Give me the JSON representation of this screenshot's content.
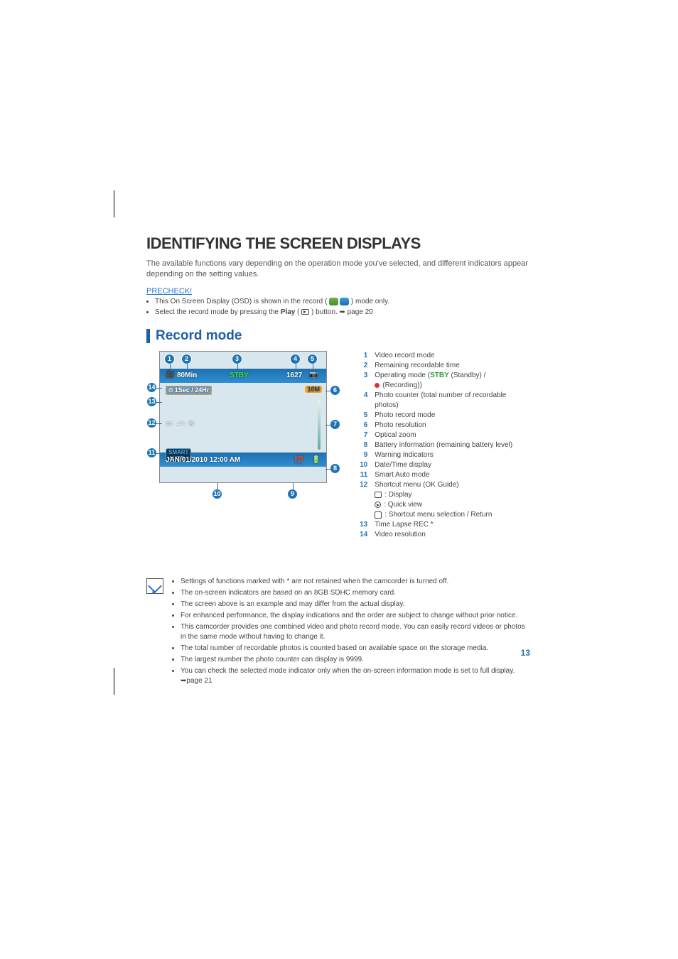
{
  "page_number": "13",
  "title": "IDENTIFYING THE SCREEN DISPLAYS",
  "intro": "The available functions vary depending on the operation mode you've selected, and different indicators appear depending on the setting values.",
  "precheck_label": "PRECHECK!",
  "precheck_items": {
    "a_pre": "This On Screen Display (OSD) is shown in the record (",
    "a_post": ") mode only.",
    "b_pre": "Select the record mode by pressing the ",
    "b_play": "Play",
    "b_mid": " (",
    "b_post": ") button. ",
    "b_ref": "page 20"
  },
  "section_title": "Record mode",
  "screen": {
    "battery_time": "80Min",
    "stby": "STBY",
    "counter": "1627",
    "timelapse": "1Sec / 24Hr",
    "res_badge": "10M",
    "datetime": "JAN/01/2010 12:00 AM"
  },
  "legend": [
    {
      "n": "1",
      "t": "Video record mode"
    },
    {
      "n": "2",
      "t": "Remaining recordable time"
    },
    {
      "n": "3",
      "t": "Operating mode (",
      "stby": "STBY",
      "t2": " (Standby) /",
      "rec": " (Recording))"
    },
    {
      "n": "4",
      "t": "Photo counter (total number of recordable photos)"
    },
    {
      "n": "5",
      "t": "Photo record mode"
    },
    {
      "n": "6",
      "t": "Photo resolution"
    },
    {
      "n": "7",
      "t": "Optical zoom"
    },
    {
      "n": "8",
      "t": "Battery information (remaining battery level)"
    },
    {
      "n": "9",
      "t": "Warning indicators"
    },
    {
      "n": "10",
      "t": "Date/Time display"
    },
    {
      "n": "11",
      "t": "Smart Auto mode"
    },
    {
      "n": "12",
      "t": "Shortcut menu (OK Guide)",
      "sub_disp": ": Display",
      "sub_qv": " : Quick view",
      "sub_sc": " : Shortcut menu selection / Return"
    },
    {
      "n": "13",
      "t": "Time Lapse REC *"
    },
    {
      "n": "14",
      "t": "Video resolution"
    }
  ],
  "notes": [
    "Settings of functions marked with * are not retained when the camcorder is turned off.",
    "The on-screen indicators are based on an 8GB SDHC memory card.",
    "The screen above is an example and may differ from the actual display.",
    "For enhanced performance, the display indications and the order are subject to change without prior notice.",
    "This camcorder provides one combined video and photo record mode. You can easily record videos or photos in the same mode without having to change it.",
    "The total number of recordable photos is counted based on available space on the storage media.",
    "The largest number the photo counter can display is 9999.",
    "You can check the selected mode indicator only when the on-screen information mode is set to full display. "
  ],
  "notes_ref": "page 21"
}
